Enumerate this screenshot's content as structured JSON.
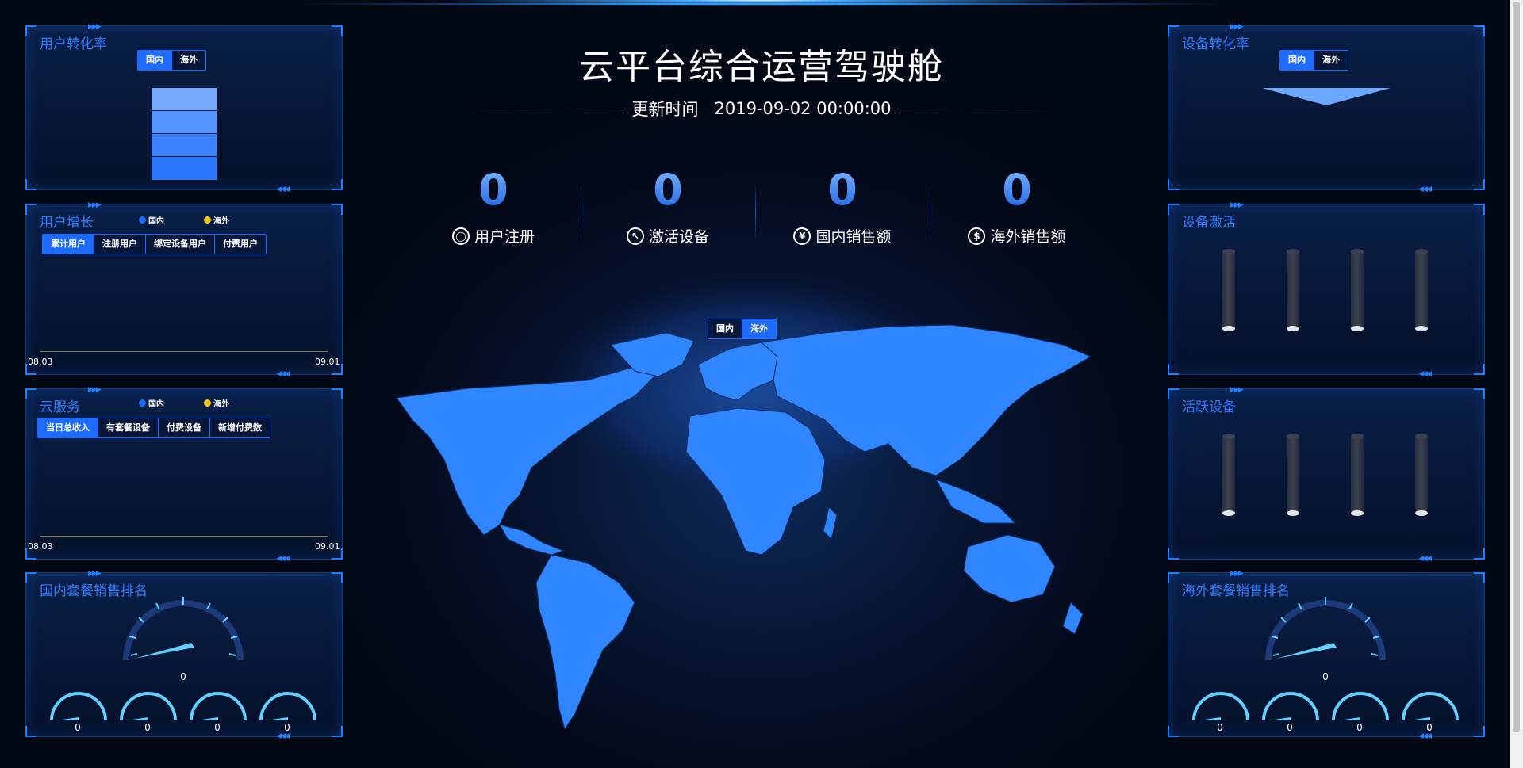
{
  "header": {
    "title": "云平台综合运营驾驶舱",
    "update_label": "更新时间",
    "update_time": "2019-09-02 00:00:00"
  },
  "stats": [
    {
      "value": "0",
      "label": "用户注册",
      "icon": "user-icon"
    },
    {
      "value": "0",
      "label": "激活设备",
      "icon": "cursor-icon"
    },
    {
      "value": "0",
      "label": "国内销售额",
      "icon": "yuan-icon"
    },
    {
      "value": "0",
      "label": "海外销售额",
      "icon": "dollar-icon"
    }
  ],
  "map_toggle": {
    "options": [
      "国内",
      "海外"
    ],
    "selected": "海外"
  },
  "left": {
    "user_conversion": {
      "title": "用户转化率",
      "tabs": [
        "国内",
        "海外"
      ],
      "selected": "国内"
    },
    "user_growth": {
      "title": "用户增长",
      "legend": [
        "国内",
        "海外"
      ],
      "tabs": [
        "累计用户",
        "注册用户",
        "绑定设备用户",
        "付费用户"
      ],
      "selected": "累计用户",
      "x_start": "08.03",
      "x_end": "09.01"
    },
    "cloud_service": {
      "title": "云服务",
      "legend": [
        "国内",
        "海外"
      ],
      "tabs": [
        "当日总收入",
        "有套餐设备",
        "付费设备",
        "新增付费数"
      ],
      "selected": "当日总收入",
      "x_start": "08.03",
      "x_end": "09.01"
    },
    "domestic_ranking": {
      "title": "国内套餐销售排名",
      "main_value": "0",
      "small_values": [
        "0",
        "0",
        "0",
        "0"
      ]
    }
  },
  "right": {
    "device_conversion": {
      "title": "设备转化率",
      "tabs": [
        "国内",
        "海外"
      ],
      "selected": "国内"
    },
    "device_activation": {
      "title": "设备激活"
    },
    "active_devices": {
      "title": "活跃设备"
    },
    "overseas_ranking": {
      "title": "海外套餐销售排名",
      "main_value": "0",
      "small_values": [
        "0",
        "0",
        "0",
        "0"
      ]
    }
  },
  "colors": {
    "accent": "#1d6cff",
    "overseas": "#f5c518",
    "domestic": "#1d6cff",
    "map": "#2f86ff"
  }
}
